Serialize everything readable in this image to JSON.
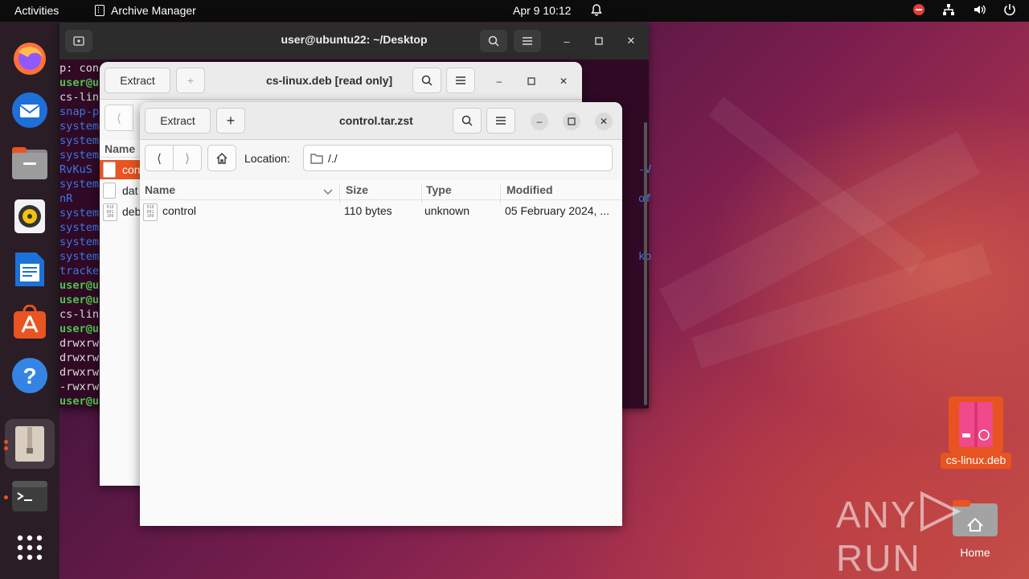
{
  "topbar": {
    "activities": "Activities",
    "app_name": "Archive Manager",
    "clock": "Apr 9  10:12"
  },
  "terminal": {
    "title": "user@ubuntu22: ~/Desktop",
    "lines": [
      {
        "text": "p: con",
        "color": "white"
      },
      {
        "text": "user@u",
        "color": "green"
      },
      {
        "text": "cs-lin",
        "color": "white"
      },
      {
        "text": "snap-p",
        "color": "blue"
      },
      {
        "text": "system",
        "color": "blue"
      },
      {
        "text": "system",
        "color": "blue"
      },
      {
        "text": "system",
        "color": "blue"
      },
      {
        "text": "RvKuS",
        "color": "blue"
      },
      {
        "text": "system",
        "color": "blue"
      },
      {
        "text": "nR",
        "color": "blue"
      },
      {
        "text": "system",
        "color": "blue"
      },
      {
        "text": "system",
        "color": "blue"
      },
      {
        "text": "system",
        "color": "blue"
      },
      {
        "text": "system",
        "color": "blue"
      },
      {
        "text": "tracke",
        "color": "blue"
      },
      {
        "text": "user@u",
        "color": "green"
      },
      {
        "text": "user@u",
        "color": "green"
      },
      {
        "text": "cs-lin",
        "color": "white"
      },
      {
        "text": "user@u",
        "color": "green"
      },
      {
        "text": "drwxrw",
        "color": "white"
      },
      {
        "text": "drwxrw",
        "color": "white"
      },
      {
        "text": "drwxrw",
        "color": "white"
      },
      {
        "text": "-rwxrw",
        "color": "white"
      },
      {
        "text": "user@u",
        "color": "green"
      }
    ],
    "right_fragments": [
      "",
      "",
      "",
      "",
      "",
      "",
      "",
      "-V",
      "",
      "of",
      "",
      "",
      "",
      "kp"
    ]
  },
  "back_window": {
    "extract_label": "Extract",
    "add_label": "+",
    "title": "cs-linux.deb [read only]",
    "col_name": "Name",
    "items": [
      "con",
      "dat",
      "deb"
    ]
  },
  "front_window": {
    "extract_label": "Extract",
    "add_label": "+",
    "title": "control.tar.zst",
    "location_label": "Location:",
    "location_value": "/./",
    "columns": {
      "name": "Name",
      "size": "Size",
      "type": "Type",
      "modified": "Modified"
    },
    "rows": [
      {
        "name": "control",
        "size": "110 bytes",
        "type": "unknown",
        "modified": "05 February 2024, ..."
      }
    ]
  },
  "desktop": {
    "deb_label": "cs-linux.deb",
    "home_label": "Home",
    "watermark": "ANY RUN"
  },
  "colors": {
    "accent": "#e95420",
    "terminal_bg": "#300a24",
    "prompt_green": "#4ec44e",
    "dir_blue": "#3b78e7"
  }
}
